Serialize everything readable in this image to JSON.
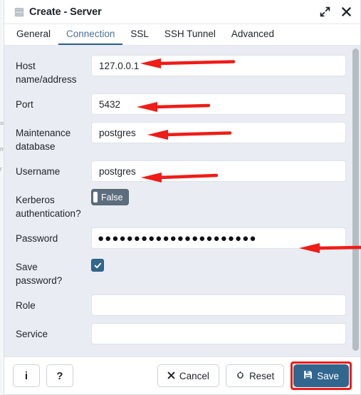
{
  "window": {
    "title": "Create - Server",
    "icon": "server-icon",
    "expand_icon": "expand-diagonal-icon",
    "close_icon": "close-x-icon"
  },
  "tabs": [
    {
      "label": "General",
      "active": false
    },
    {
      "label": "Connection",
      "active": true
    },
    {
      "label": "SSL",
      "active": false
    },
    {
      "label": "SSH Tunnel",
      "active": false
    },
    {
      "label": "Advanced",
      "active": false
    }
  ],
  "form": {
    "fields": [
      {
        "label": "Host name/address",
        "value": "127.0.0.1",
        "placeholder": "",
        "type": "text",
        "annotated": true
      },
      {
        "label": "Port",
        "value": "5432",
        "placeholder": "",
        "type": "text",
        "annotated": true
      },
      {
        "label": "Maintenance database",
        "value": "postgres",
        "placeholder": "",
        "type": "text",
        "annotated": true
      },
      {
        "label": "Username",
        "value": "postgres",
        "placeholder": "",
        "type": "text",
        "annotated": true
      },
      {
        "label": "Kerberos authentication?",
        "value": "False",
        "type": "toggle",
        "annotated": false
      },
      {
        "label": "Password",
        "value": "●●●●●●●●●●●●●●●●●●●●●●",
        "placeholder": "",
        "type": "password",
        "annotated": true
      },
      {
        "label": "Save password?",
        "value": "checked",
        "type": "checkbox",
        "annotated": false
      },
      {
        "label": "Role",
        "value": "",
        "placeholder": "",
        "type": "text",
        "annotated": false
      },
      {
        "label": "Service",
        "value": "",
        "placeholder": "",
        "type": "text",
        "annotated": false
      }
    ]
  },
  "footer": {
    "info_label": "i",
    "help_label": "?",
    "cancel_label": "Cancel",
    "reset_label": "Reset",
    "save_label": "Save",
    "cancel_icon": "x-icon",
    "reset_icon": "recycle-icon",
    "save_icon": "floppy-disk-icon"
  },
  "colors": {
    "accent": "#31678f",
    "tab_active": "#2c5f88",
    "annotation_red": "#ef1c17",
    "form_bg": "#e9ecf2",
    "toggle_bg": "#5d6d7e"
  },
  "annotations": {
    "arrow_color": "#ef1c17",
    "arrow_count": 5,
    "note": "red left-pointing arrows highlighting host, port, database, username and password fields"
  },
  "bleed": {
    "glyph_a": "≡",
    "glyph_b": "m",
    "glyph_c": "r"
  }
}
